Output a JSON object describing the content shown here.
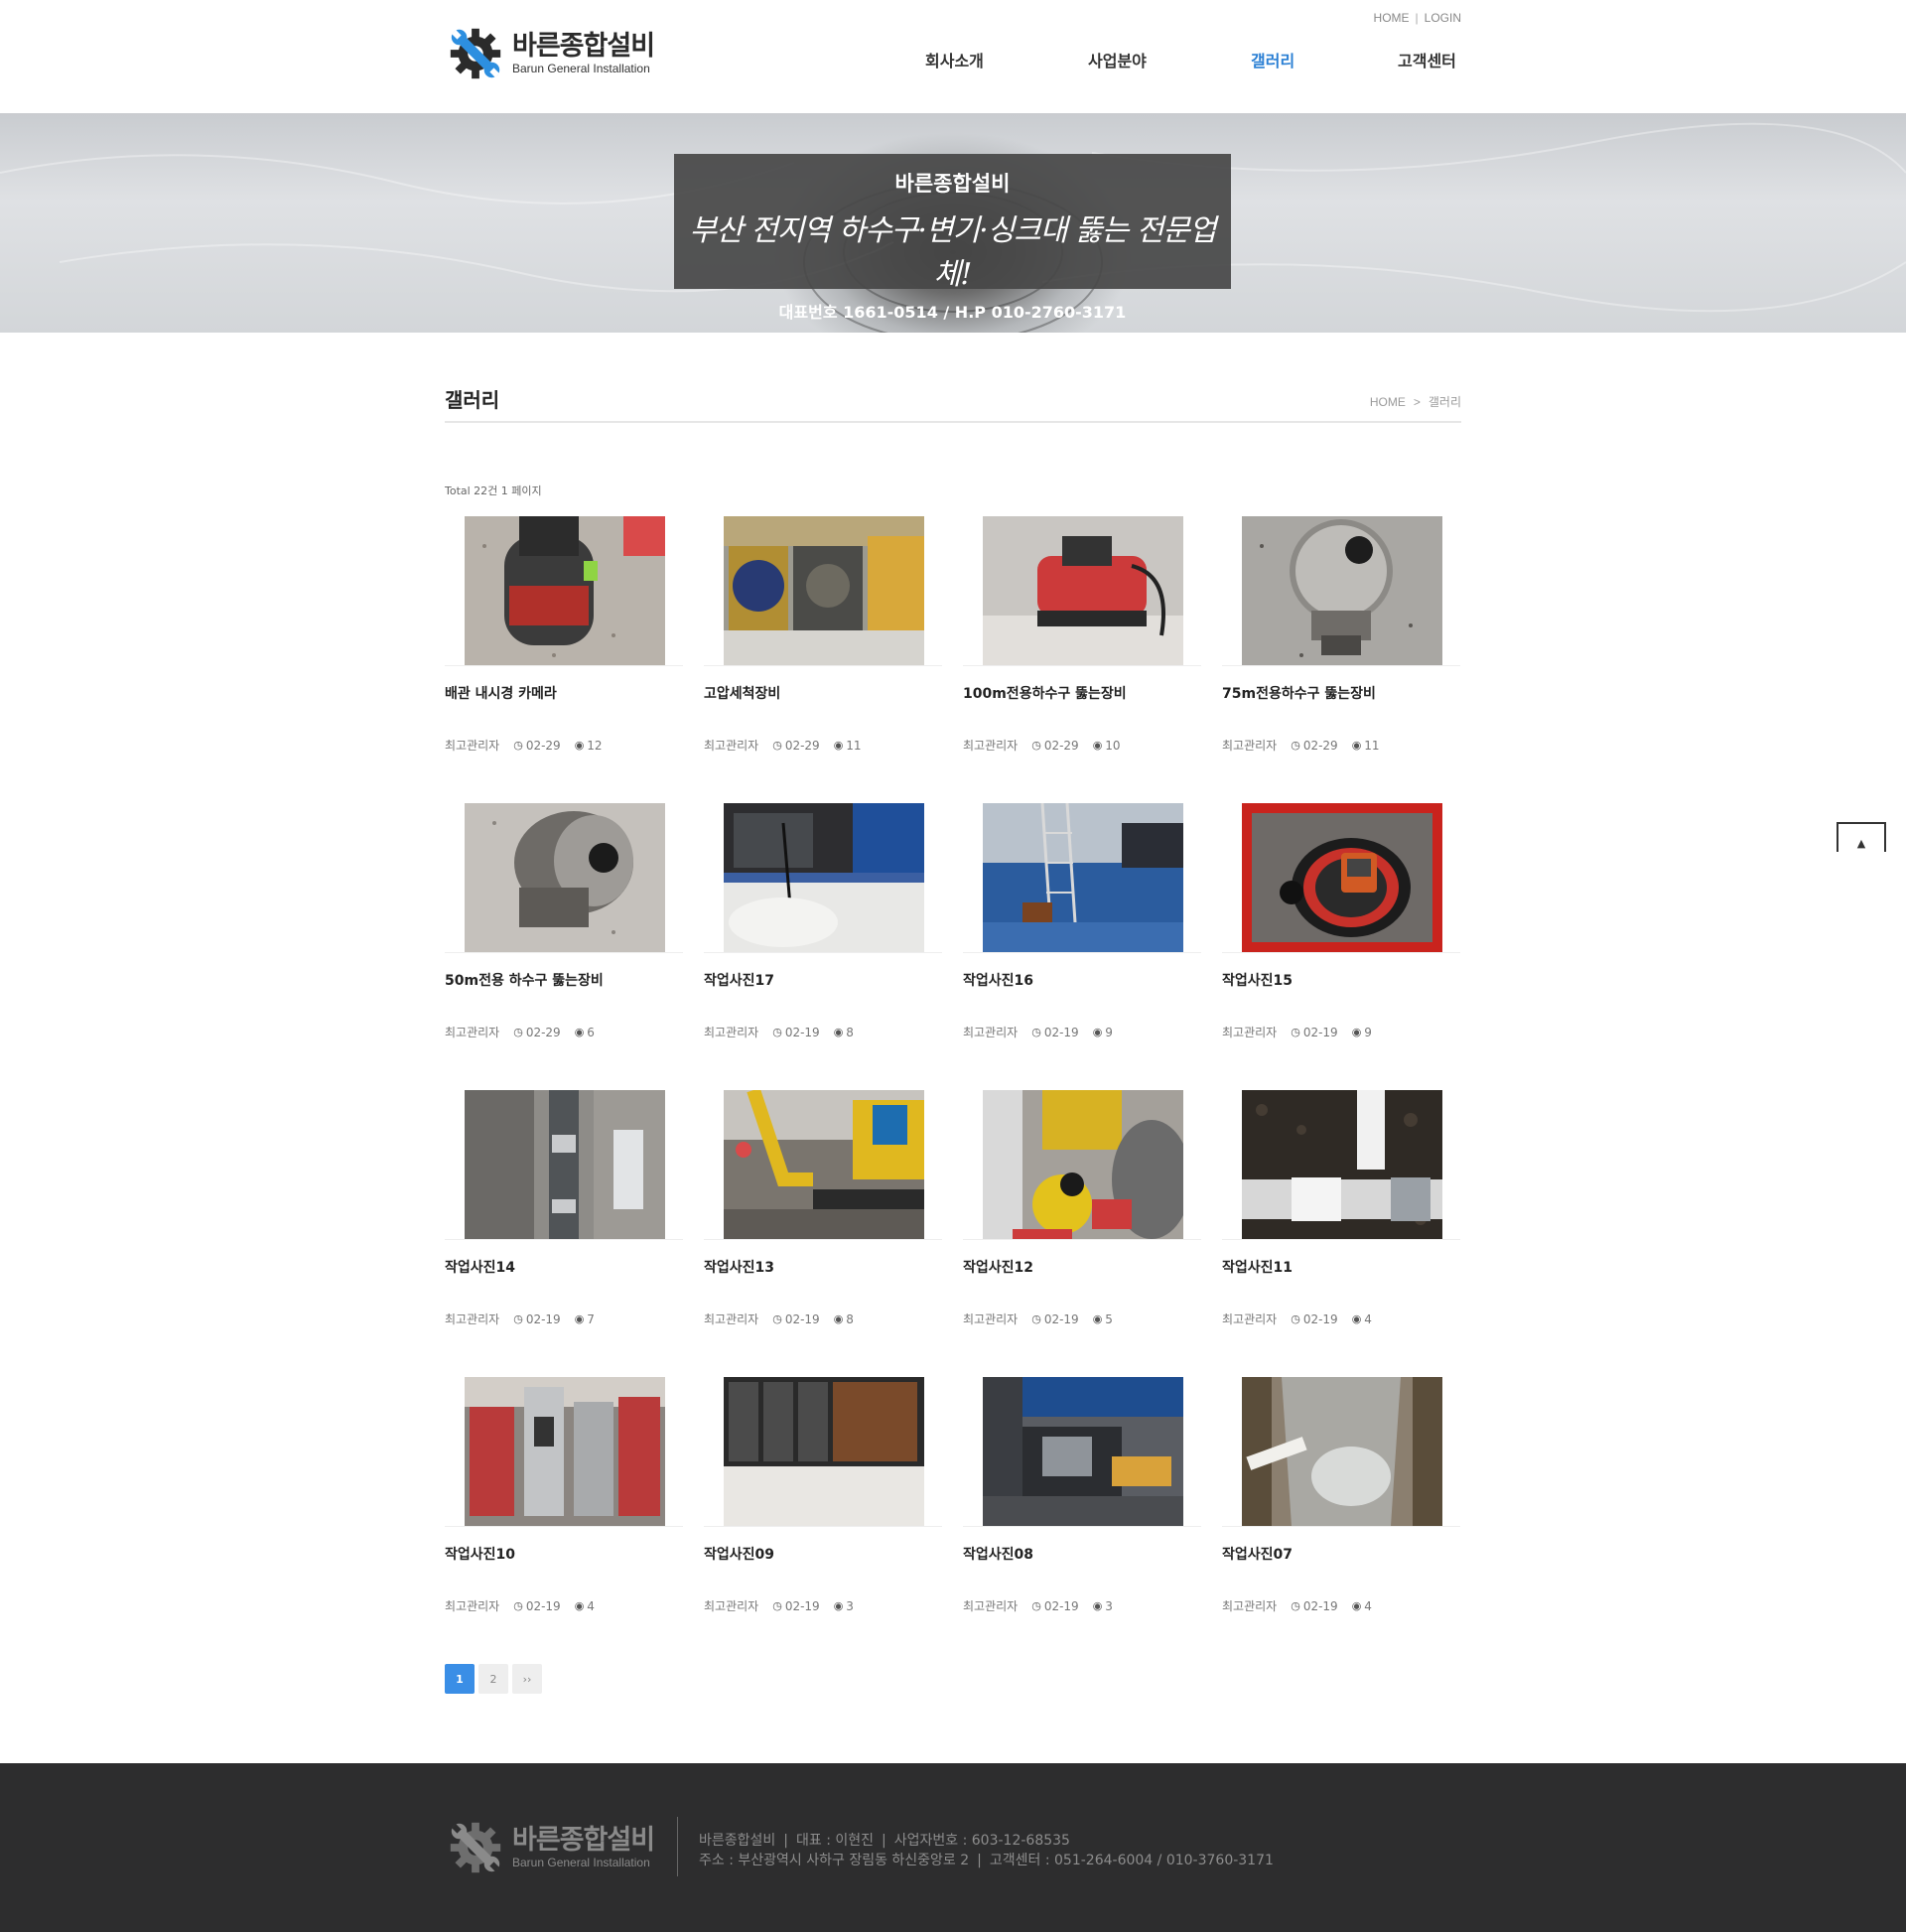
{
  "header": {
    "logo_ko": "바른종합설비",
    "logo_en": "Barun General Installation",
    "util_home": "HOME",
    "util_sep": "|",
    "util_login": "LOGIN",
    "nav": [
      "회사소개",
      "사업분야",
      "갤러리",
      "고객센터"
    ],
    "active_nav": "갤러리"
  },
  "banner": {
    "title": "바른종합설비",
    "slogan": "부산 전지역 하수구·변기·싱크대 뚫는 전문업체!",
    "phone": "대표번호 1661-0514 / H.P 010-2760-3171"
  },
  "page": {
    "title": "갤러리",
    "breadcrumb_home": "HOME",
    "breadcrumb_sep": ">",
    "breadcrumb_current": "갤러리",
    "total_text": "Total 22건 1 페이지"
  },
  "gallery": [
    {
      "title": "배관 내시경 카메라",
      "author": "최고관리자",
      "date": "02-29",
      "views": "12",
      "photo": "camera-reel"
    },
    {
      "title": "고압세척장비",
      "author": "최고관리자",
      "date": "02-29",
      "views": "11",
      "photo": "high-pressure-equipment"
    },
    {
      "title": "100m전용하수구 뚫는장비",
      "author": "최고관리자",
      "date": "02-29",
      "views": "10",
      "photo": "red-drain-machine"
    },
    {
      "title": "75m전용하수구 뚫는장비",
      "author": "최고관리자",
      "date": "02-29",
      "views": "11",
      "photo": "steel-drum-machine"
    },
    {
      "title": "50m전용 하수구 뚫는장비",
      "author": "최고관리자",
      "date": "02-29",
      "views": "6",
      "photo": "steel-drum-machine-2"
    },
    {
      "title": "작업사진17",
      "author": "최고관리자",
      "date": "02-19",
      "views": "8",
      "photo": "work-site"
    },
    {
      "title": "작업사진16",
      "author": "최고관리자",
      "date": "02-19",
      "views": "9",
      "photo": "parking-garage"
    },
    {
      "title": "작업사진15",
      "author": "최고관리자",
      "date": "02-19",
      "views": "9",
      "photo": "camera-case"
    },
    {
      "title": "작업사진14",
      "author": "최고관리자",
      "date": "02-19",
      "views": "7",
      "photo": "trench-pipe"
    },
    {
      "title": "작업사진13",
      "author": "최고관리자",
      "date": "02-19",
      "views": "8",
      "photo": "excavator"
    },
    {
      "title": "작업사진12",
      "author": "최고관리자",
      "date": "02-19",
      "views": "5",
      "photo": "excavation-worker"
    },
    {
      "title": "작업사진11",
      "author": "최고관리자",
      "date": "02-19",
      "views": "4",
      "photo": "pvc-pipe"
    },
    {
      "title": "작업사진10",
      "author": "최고관리자",
      "date": "02-19",
      "views": "4",
      "photo": "equipment-rack"
    },
    {
      "title": "작업사진09",
      "author": "최고관리자",
      "date": "02-19",
      "views": "3",
      "photo": "cable-reels"
    },
    {
      "title": "작업사진08",
      "author": "최고관리자",
      "date": "02-19",
      "views": "3",
      "photo": "pump-equipment"
    },
    {
      "title": "작업사진07",
      "author": "최고관리자",
      "date": "02-19",
      "views": "4",
      "photo": "drain-hole"
    }
  ],
  "pagination": {
    "pages": [
      "1",
      "2"
    ],
    "next": "››",
    "current": "1"
  },
  "footer": {
    "logo_ko": "바른종합설비",
    "logo_en": "Barun General Installation",
    "line1": [
      "바른종합설비",
      "대표 : 이현진",
      "사업자번호 : 603-12-68535"
    ],
    "line2": [
      "주소 : 부산광역시 사하구 장림동 하신중앙로 2",
      "고객센터 : 051-264-6004 / 010-3760-3171"
    ],
    "sep": "|"
  },
  "colors": {
    "accent": "#2a7fd4",
    "pager_active": "#3a8ee6",
    "footer_bg": "#2d2d2e",
    "logo_blue": "#2d8fe0"
  },
  "icons": {
    "clock": "clock-icon",
    "eye": "eye-icon",
    "top": "arrow-up-icon"
  }
}
